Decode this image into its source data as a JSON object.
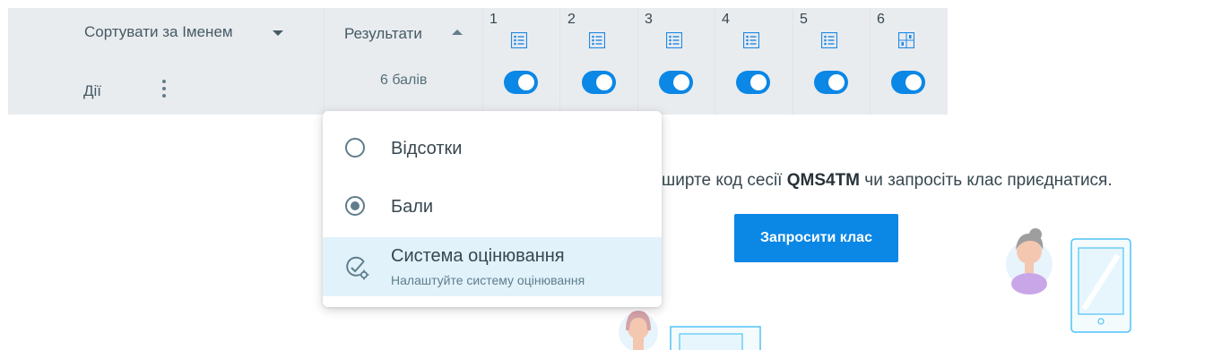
{
  "header": {
    "sort_label": "Сортувати за Іменем",
    "actions_label": "Дії",
    "results_label": "Результати",
    "score_label": "6 балів",
    "questions": [
      {
        "number": "1",
        "icon": "list-icon",
        "enabled": true
      },
      {
        "number": "2",
        "icon": "list-icon",
        "enabled": true
      },
      {
        "number": "3",
        "icon": "list-icon",
        "enabled": true
      },
      {
        "number": "4",
        "icon": "list-icon",
        "enabled": true
      },
      {
        "number": "5",
        "icon": "list-icon",
        "enabled": true
      },
      {
        "number": "6",
        "icon": "grid-icon",
        "enabled": true
      }
    ]
  },
  "menu": {
    "items": [
      {
        "label": "Відсотки",
        "selected": false
      },
      {
        "label": "Бали",
        "selected": true
      },
      {
        "label": "Система оцінювання",
        "sublabel": "Налаштуйте систему оцінювання"
      }
    ]
  },
  "share": {
    "prefix": "ширте код сесії ",
    "code": "QMS4TM",
    "suffix": " чи запросіть клас приєднатися."
  },
  "invite_button": "Запросити клас",
  "colors": {
    "accent": "#0b87e6",
    "header_bg": "#e9ecef",
    "menu_highlight": "#e1f2fb"
  }
}
